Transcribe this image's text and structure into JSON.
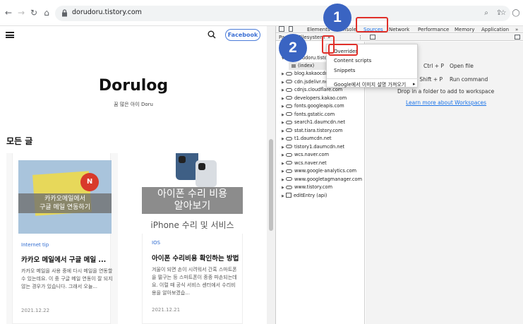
{
  "browser": {
    "url": "dorudoru.tistory.com",
    "back_icon": "arrow-left-icon",
    "forward_icon": "arrow-right-icon",
    "reload_icon": "reload-icon",
    "home_icon": "home-icon"
  },
  "blog": {
    "facebook_label": "Facebook",
    "title": "Dorulog",
    "subtitle": "꿈 많은 아이 Doru",
    "section_title": "모든 글",
    "cards": [
      {
        "thumb_caption_line1": "카카오메일에서",
        "thumb_caption_line2": "구글 메일 연동하기",
        "category": "Internet tip",
        "title": "카카오 메일에서 구글 메일 ...",
        "excerpt": "카카오 메일을 사용 중에 다시 메일을 연동할 수 있는데요. 이 중 구글 메일 연동이 잘 되지 않는 경우가 있습니다. 그래서 오늘...",
        "date": "2021.12.22"
      },
      {
        "thumb_caption_line1": "아이폰 수리 비용",
        "thumb_caption_line2": "알아보기",
        "thumb_subtitle": "iPhone 수리 및 서비스",
        "category": "IOS",
        "title": "아이폰 수리비용 확인하는 방법",
        "excerpt": "겨울이 되면 손이 시려워서 간혹 스마트폰을 떨구는 등 스마트폰이 종종 파손되는데요. 이럴 때 공식 서비스 센터에서 수리비용을 알아보겠습...",
        "date": "2021.12.21"
      }
    ]
  },
  "devtools": {
    "tabs": [
      "Elements",
      "Console",
      "Sources",
      "Network",
      "Performance",
      "Memory",
      "Application"
    ],
    "active_tab": "Sources",
    "sources_tabs": [
      "Page",
      "Filesystem"
    ],
    "more_tabs_label": "»",
    "tree": [
      {
        "label": "dorudoru.tistory.com",
        "type": "folder",
        "indent": 0,
        "open": true
      },
      {
        "label": "(index)",
        "type": "file",
        "indent": 1,
        "selected": true
      },
      {
        "label": "blog.kakaocdn.net",
        "type": "cloud",
        "indent": 0
      },
      {
        "label": "cdn.jsdelivr.net",
        "type": "cloud",
        "indent": 0
      },
      {
        "label": "cdnjs.cloudflare.com",
        "type": "cloud",
        "indent": 0
      },
      {
        "label": "developers.kakao.com",
        "type": "cloud",
        "indent": 0
      },
      {
        "label": "fonts.googleapis.com",
        "type": "cloud",
        "indent": 0
      },
      {
        "label": "fonts.gstatic.com",
        "type": "cloud",
        "indent": 0
      },
      {
        "label": "search1.daumcdn.net",
        "type": "cloud",
        "indent": 0
      },
      {
        "label": "stat.tiara.tistory.com",
        "type": "cloud",
        "indent": 0
      },
      {
        "label": "t1.daumcdn.net",
        "type": "cloud",
        "indent": 0
      },
      {
        "label": "tistory1.daumcdn.net",
        "type": "cloud",
        "indent": 0
      },
      {
        "label": "wcs.naver.com",
        "type": "cloud",
        "indent": 0
      },
      {
        "label": "wcs.naver.net",
        "type": "cloud",
        "indent": 0
      },
      {
        "label": "www.google-analytics.com",
        "type": "cloud",
        "indent": 0
      },
      {
        "label": "www.googletagmanager.com",
        "type": "cloud",
        "indent": 0
      },
      {
        "label": "www.tistory.com",
        "type": "cloud",
        "indent": 0
      },
      {
        "label": "editEntry (api)",
        "type": "frame",
        "indent": 0
      }
    ],
    "shortcuts": [
      {
        "keys": "Ctrl + P",
        "action": "Open file"
      },
      {
        "keys": "Ctrl + Shift + P",
        "action": "Run command"
      }
    ],
    "drop_text": "Drop in a folder to add to workspace",
    "workspace_link": "Learn more about Workspaces",
    "context_menu": [
      "Overrides",
      "Content scripts",
      "Snippets",
      "Google에서 이미지 설명 가져오기"
    ]
  },
  "annotations": {
    "marker1": "1",
    "marker2": "2",
    "color": "#e0302a",
    "marker_color": "#3a64c2"
  }
}
